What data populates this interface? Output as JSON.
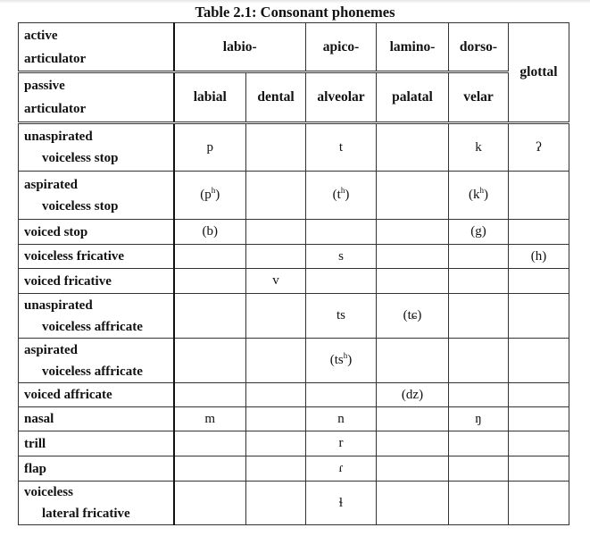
{
  "caption": "Table 2.1: Consonant phonemes",
  "header": {
    "active_label": [
      "active",
      "articulator"
    ],
    "passive_label": [
      "passive",
      "articulator"
    ],
    "active_groups": {
      "labio": "labio-",
      "apico": "apico-",
      "lamino": "lamino-",
      "dorso": "dorso-",
      "glottal": "glottal"
    },
    "passive_places": [
      "labial",
      "dental",
      "alveolar",
      "palatal",
      "velar"
    ]
  },
  "rows": [
    {
      "label": [
        "unaspirated",
        "voiceless stop"
      ],
      "cells": [
        "p",
        "",
        "t",
        "",
        "k",
        "ʔ"
      ]
    },
    {
      "label": [
        "aspirated",
        "voiceless stop"
      ],
      "cells": [
        "(pʰ)",
        "",
        "(tʰ)",
        "",
        "(kʰ)",
        ""
      ]
    },
    {
      "label": [
        "voiced stop"
      ],
      "cells": [
        "(b)",
        "",
        "",
        "",
        "(g)",
        ""
      ]
    },
    {
      "label": [
        "voiceless fricative"
      ],
      "cells": [
        "",
        "",
        "s",
        "",
        "",
        "(h)"
      ]
    },
    {
      "label": [
        "voiced fricative"
      ],
      "cells": [
        "",
        "v",
        "",
        "",
        "",
        ""
      ]
    },
    {
      "label": [
        "unaspirated",
        "voiceless affricate"
      ],
      "cells": [
        "",
        "",
        "ts",
        "(tɕ)",
        "",
        ""
      ]
    },
    {
      "label": [
        "aspirated",
        "voiceless affricate"
      ],
      "cells": [
        "",
        "",
        "(tsʰ)",
        "",
        "",
        ""
      ]
    },
    {
      "label": [
        "voiced affricate"
      ],
      "cells": [
        "",
        "",
        "",
        "(dz)",
        "",
        ""
      ]
    },
    {
      "label": [
        "nasal"
      ],
      "cells": [
        "m",
        "",
        "n",
        "",
        "ŋ",
        ""
      ]
    },
    {
      "label": [
        "trill"
      ],
      "cells": [
        "",
        "",
        "r",
        "",
        "",
        ""
      ]
    },
    {
      "label": [
        "flap"
      ],
      "cells": [
        "",
        "",
        "ɾ",
        "",
        "",
        ""
      ]
    },
    {
      "label": [
        "voiceless",
        "lateral fricative"
      ],
      "cells": [
        "",
        "",
        "ɬ",
        "",
        "",
        ""
      ]
    }
  ]
}
